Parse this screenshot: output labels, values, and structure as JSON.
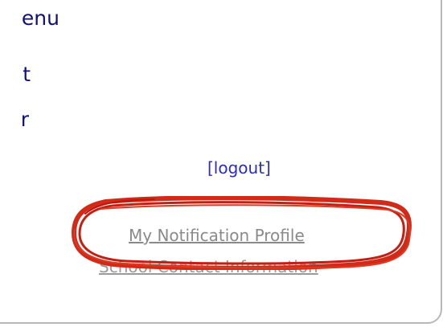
{
  "menu": {
    "items": [
      {
        "label": "enu"
      },
      {
        "label": "t"
      },
      {
        "label": "r"
      }
    ]
  },
  "account": {
    "logout_label": "[logout]"
  },
  "links": {
    "notification_profile": "My Notification Profile",
    "school_contact": "School Contact Information"
  },
  "annotation": {
    "stroke_color": "#d22a18"
  }
}
